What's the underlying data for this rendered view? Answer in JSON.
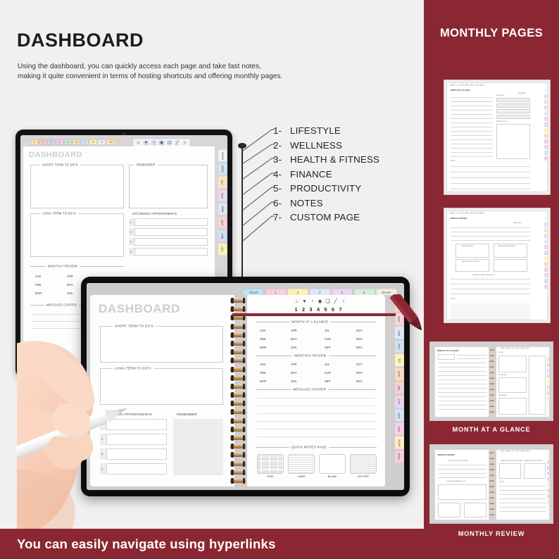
{
  "header": {
    "title": "DASHBOARD",
    "subtitle": "Using the dashboard, you can quickly access each page and take fast notes,\nmaking it quite convenient in terms of hosting shortcuts and offering monthly pages."
  },
  "legend": {
    "items": [
      {
        "num": "1-",
        "label": "LIFESTYLE"
      },
      {
        "num": "2-",
        "label": "WELLNESS"
      },
      {
        "num": "3-",
        "label": "HEALTH & FITNESS"
      },
      {
        "num": "4-",
        "label": "FINANCE"
      },
      {
        "num": "5-",
        "label": "PRODUCTIVITY"
      },
      {
        "num": "6-",
        "label": "NOTES"
      },
      {
        "num": "7-",
        "label": "CUSTOM PAGE"
      }
    ]
  },
  "planner": {
    "page_title": "DASHBOARD",
    "sections": {
      "short_term": "SHORT TERM TO DO'S",
      "long_term": "LONG TERM TO DO'S",
      "remember": "REMEMBER",
      "appointments": "UPCOMING APPOINTMENTS",
      "monthly_review": "MONTHLY REVIEW",
      "month_at_a_glance": "MONTH AT A GLANCE",
      "message_center": "MESSAGE CENTER",
      "quick_notes": "QUICK NOTES PAGE"
    },
    "appointment_numbers": [
      "1.",
      "2.",
      "3.",
      "4."
    ],
    "months_grid": [
      [
        "JAN",
        "APR",
        "JUL",
        "OCT"
      ],
      [
        "FEB",
        "MAY",
        "AUG",
        "NOV"
      ],
      [
        "MAR",
        "JUN",
        "SEP",
        "DEC"
      ]
    ],
    "months_half": [
      [
        "JAN",
        "APR"
      ],
      [
        "FEB",
        "MAY"
      ],
      [
        "MAR",
        "JUN"
      ]
    ],
    "quick_note_styles": [
      "GRID",
      "LINED",
      "BLANK",
      "DOTTED"
    ],
    "page_number_tabs": [
      "1",
      "2",
      "3",
      "4",
      "5",
      "6",
      "7",
      "8",
      "9",
      "10"
    ],
    "page_number_tab_colors": [
      "#fbe6b0",
      "#f7c9c9",
      "#d9d4ef",
      "#f3cfe3",
      "#cfe9cf",
      "#f6dfc0",
      "#cfe4f5",
      "#fbf0b5",
      "#efefef",
      "#ffe2b8"
    ],
    "icon_numbers": [
      "1",
      "2",
      "3",
      "4",
      "5",
      "6",
      "7"
    ],
    "toolbar_icons": [
      "home-icon",
      "heart-icon",
      "clock-icon",
      "target-icon",
      "note-icon",
      "pencil-icon",
      "circle-icon"
    ],
    "toolbar_icon_glyphs": [
      "⌂",
      "♥",
      "◔",
      "◉",
      "❑",
      "╱",
      "○"
    ],
    "toolbar_icon_colors": [
      "#f2ece0",
      "#e9d4e6",
      "#d8def2",
      "#cfd9ef",
      "#d3e7f2",
      "#ebe4f3",
      "#ececec"
    ],
    "side_tabs_back": [
      "DASH",
      "YEAR",
      "JAN",
      "FEB",
      "MAR",
      "APR",
      "MAY",
      "JUN"
    ],
    "side_tabs_back_colors": [
      "#f2f2f2",
      "#cfe7f4",
      "#fbe3c6",
      "#ecd9f0",
      "#dfe6f5",
      "#f7d2d8",
      "#cfe0f3",
      "#faf2bb"
    ],
    "side_tabs_front": [
      "MAR",
      "APR",
      "MAY",
      "JUN",
      "JUL",
      "AUG",
      "SEP",
      "OCT",
      "NOV",
      "DEC",
      "NOTE",
      "GRID"
    ],
    "side_tabs_front_colors": [
      "#f8d9c0",
      "#f6d5da",
      "#dfe7f6",
      "#cfe0f2",
      "#faf3bd",
      "#f6dcc2",
      "#f3cfd9",
      "#e6d6f1",
      "#cfe3f5",
      "#f7cfe0",
      "#fbeec2",
      "#f2cfe5"
    ],
    "top_tabs_front": [
      "YEAR",
      "1",
      "2",
      "3",
      "4",
      "5",
      "DASH"
    ],
    "top_tabs_front_colors": [
      "#bfe5f2",
      "#f7cfdd",
      "#fbf0b7",
      "#e0e7f7",
      "#ead7f2",
      "#d4eedd",
      "#f3efe3"
    ]
  },
  "right_panel": {
    "title": "MONTHLY PAGES",
    "thumbnails": [
      {
        "label": "MONTH AT A GLANCE",
        "orientation": "vertical",
        "page_title": "MONTH AT A GLANCE",
        "sub_a": "PRIORITIES",
        "sub_b": "CALENDAR",
        "sub_c": "MONTH TO-DOS",
        "sub_d": "NOTES"
      },
      {
        "label": "MONTHLY REVIEW",
        "orientation": "vertical",
        "page_title": "MONTHLY REVIEW",
        "sub_a": "HIGHLIGHTS",
        "sub_b": "WHAT WENT WELL",
        "sub_c": "WHAT CAN BE IMPROVED",
        "sub_d": "GOALS FOR NEXT MONTH",
        "sub_e": "WHAT DID I LEARN THIS MONTH?",
        "sub_f": "NOTES"
      },
      {
        "label": "MONTH AT A GLANCE",
        "orientation": "horizontal",
        "page_title": "MONTHLY AT A GLANCE",
        "sub_a": "NOTES",
        "sub_b": "PRIORITIES",
        "sub_c": "REMINDERS"
      },
      {
        "label": "MONTHLY REVIEW",
        "orientation": "horizontal",
        "page_title": "MONTHLY REVIEW",
        "sub_a": "HIGHLIGHTS OF THE MONTH",
        "sub_b": "WHAT I AM GRATEFUL FOR",
        "sub_c": "WHAT WENT WELL THIS MONTH?",
        "sub_d": "WHAT CAN BE IMPROVED?",
        "sub_e": "NOTES"
      }
    ]
  },
  "footer": {
    "text": "You can easily navigate using hyperlinks"
  },
  "colors": {
    "brand_red": "#8a2733",
    "page_bg": "#f1efef",
    "text_dark": "#1c1c1c"
  }
}
